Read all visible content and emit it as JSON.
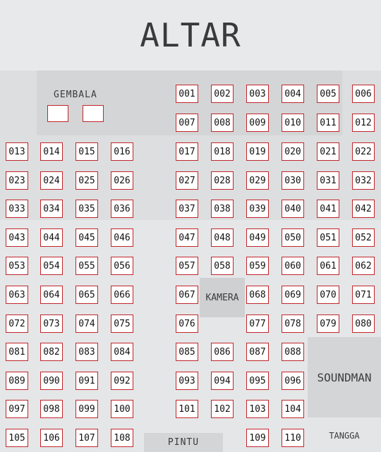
{
  "altar": {
    "title": "ALTAR"
  },
  "pastor": {
    "label": "GEMBALA"
  },
  "camera": {
    "label": "KAMERA"
  },
  "soundman": {
    "label": "SOUNDMAN"
  },
  "stairs": {
    "label": "TANGGA"
  },
  "door": {
    "label": "PINTU"
  },
  "colors": {
    "seat_border": "#c0262c",
    "seat_fill": "#ffffff"
  },
  "seats": [
    [
      "001",
      "002",
      "003",
      "004",
      "005",
      "006"
    ],
    [
      "007",
      "008",
      "009",
      "010",
      "011",
      "012"
    ],
    [
      "013",
      "014",
      "015",
      "016",
      "017",
      "018",
      "019",
      "020",
      "021",
      "022"
    ],
    [
      "023",
      "024",
      "025",
      "026",
      "027",
      "028",
      "029",
      "030",
      "031",
      "032"
    ],
    [
      "033",
      "034",
      "035",
      "036",
      "037",
      "038",
      "039",
      "040",
      "041",
      "042"
    ],
    [
      "043",
      "044",
      "045",
      "046",
      "047",
      "048",
      "049",
      "050",
      "051",
      "052"
    ],
    [
      "053",
      "054",
      "055",
      "056",
      "057",
      "058",
      "059",
      "060",
      "061",
      "062"
    ],
    [
      "063",
      "064",
      "065",
      "066",
      "067",
      "068",
      "069",
      "070",
      "071"
    ],
    [
      "072",
      "073",
      "074",
      "075",
      "076",
      "077",
      "078",
      "079",
      "080"
    ],
    [
      "081",
      "082",
      "083",
      "084",
      "085",
      "086",
      "087",
      "088"
    ],
    [
      "089",
      "090",
      "091",
      "092",
      "093",
      "094",
      "095",
      "096"
    ],
    [
      "097",
      "098",
      "099",
      "100",
      "101",
      "102",
      "103",
      "104"
    ],
    [
      "105",
      "106",
      "107",
      "108",
      "109",
      "110"
    ]
  ]
}
